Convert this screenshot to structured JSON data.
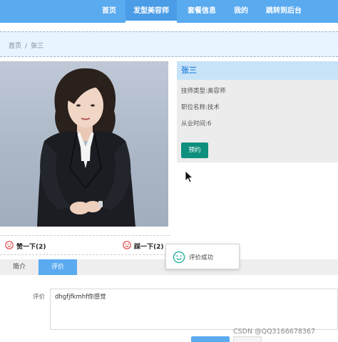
{
  "nav": {
    "items": [
      {
        "label": "首页"
      },
      {
        "label": "发型美容师"
      },
      {
        "label": "套餐信息"
      },
      {
        "label": "我的"
      },
      {
        "label": "跳转到后台"
      }
    ],
    "active_index": 1
  },
  "breadcrumb": {
    "home": "首页",
    "separator": "/",
    "current": "张三"
  },
  "stylist": {
    "name": "张三",
    "type_label": "技师类型:",
    "type_value": "美容师",
    "position_label": "职位名称:",
    "position_value": "技术",
    "years_label": "从业时间:",
    "years_value": "6",
    "book_button": "预约"
  },
  "votes": {
    "like_label": "赞一下(2)",
    "dislike_label": "踩一下(2)",
    "icon": "frown-face-icon"
  },
  "toast": {
    "message": "评价成功",
    "icon": "smile-face-icon"
  },
  "tabs": {
    "items": [
      {
        "label": "简介"
      },
      {
        "label": "评价"
      }
    ],
    "active_index": 1
  },
  "review": {
    "label": "评价",
    "value": "dhgfjfkmhf你感觉"
  },
  "watermark": "CSDN @QQ3166678367",
  "colors": {
    "nav_bg": "#5aaaf0",
    "accent": "#3a8de0",
    "book_button": "#0f8f7e",
    "vote_icon": "#e03a3a",
    "toast_icon": "#28b4a0"
  }
}
